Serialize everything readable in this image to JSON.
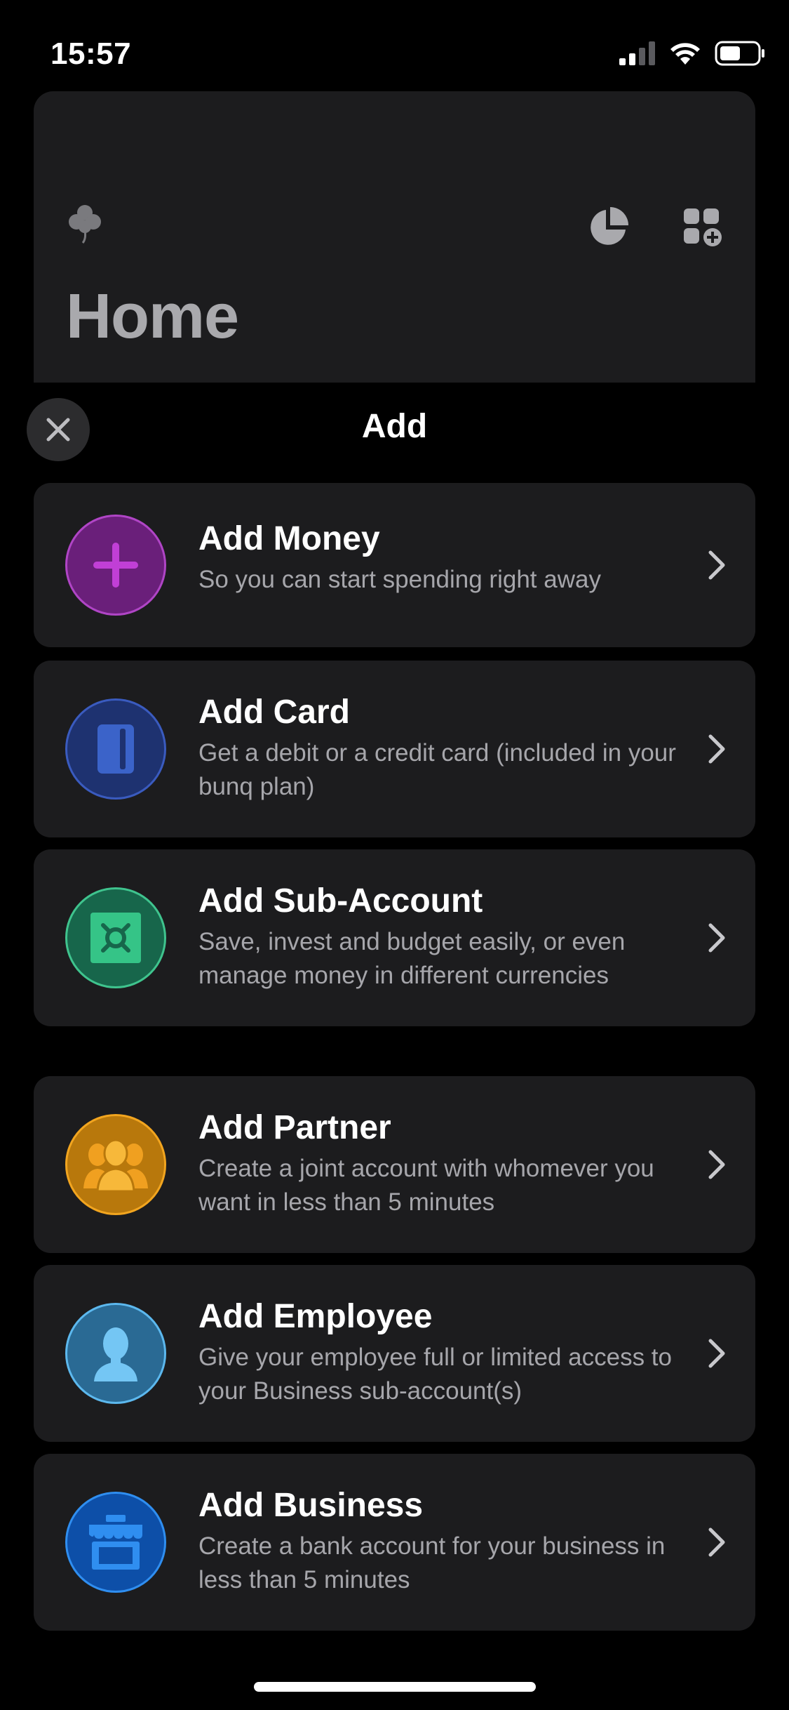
{
  "status_bar": {
    "time": "15:57",
    "icons": [
      "signal-icon",
      "wifi-icon",
      "battery-icon"
    ]
  },
  "background_screen": {
    "title": "Home",
    "icons": [
      "clover-icon",
      "pie-chart-icon",
      "add-widget-icon"
    ]
  },
  "sheet": {
    "title": "Add",
    "close_icon": "close-icon"
  },
  "options": [
    {
      "title": "Add Money",
      "description": "So you can start spending right away",
      "icon": "plus-icon",
      "color": "#9b2fae"
    },
    {
      "title": "Add Card",
      "description": "Get a debit or a credit card (included in your bunq plan)",
      "icon": "card-icon",
      "color": "#2f4fa8"
    },
    {
      "title": "Add Sub-Account",
      "description": "Save, invest and budget easily, or even manage money in different currencies",
      "icon": "safe-icon",
      "color": "#2aa874"
    },
    {
      "title": "Add Partner",
      "description": "Create a joint account with whomever you want in less than 5 minutes",
      "icon": "people-icon",
      "color": "#e89a12"
    },
    {
      "title": "Add Employee",
      "description": "Give your employee full or limited access to your Business sub-account(s)",
      "icon": "person-icon",
      "color": "#3d9bd6"
    },
    {
      "title": "Add Business",
      "description": "Create a bank account for your business in less than 5 minutes",
      "icon": "storefront-icon",
      "color": "#1a6fd8"
    }
  ],
  "colors": {
    "background": "#000000",
    "card": "#1c1c1e",
    "secondary_text": "#a6a6ab"
  }
}
